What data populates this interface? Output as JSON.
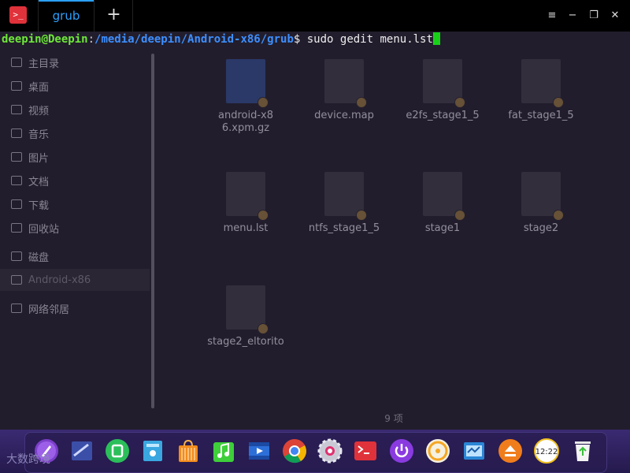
{
  "terminal": {
    "app_icon": ">_",
    "tab_label": "grub",
    "add_tab": "+",
    "prompt_user": "deepin@Deepin",
    "prompt_sep": ":",
    "prompt_path": "/media/deepin/Android-x86/grub",
    "prompt_dollar": "$",
    "command": " sudo gedit menu.lst",
    "menu_glyph": "≡",
    "minimize_glyph": "−",
    "maximize_glyph": "❐",
    "close_glyph": "✕"
  },
  "file_manager": {
    "sidebar": [
      {
        "label": "主目录"
      },
      {
        "label": "桌面"
      },
      {
        "label": "视频"
      },
      {
        "label": "音乐"
      },
      {
        "label": "图片"
      },
      {
        "label": "文档"
      },
      {
        "label": "下载"
      },
      {
        "label": "回收站"
      },
      {
        "label": "磁盘"
      },
      {
        "label": "Android-x86"
      },
      {
        "label": "网络邻居"
      }
    ],
    "files": [
      {
        "name": "android-x86.xpm.gz"
      },
      {
        "name": "device.map"
      },
      {
        "name": "e2fs_stage1_5"
      },
      {
        "name": "fat_stage1_5"
      },
      {
        "name": "menu.lst"
      },
      {
        "name": "ntfs_stage1_5"
      },
      {
        "name": "stage1"
      },
      {
        "name": "stage2"
      },
      {
        "name": "stage2_eltorito"
      }
    ],
    "status": "9 项"
  },
  "dock": {
    "icons": [
      "launcher-icon",
      "screenshot-icon",
      "wechat-icon",
      "file-manager-icon",
      "app-store-icon",
      "music-icon",
      "video-icon",
      "chrome-icon",
      "settings-icon",
      "terminal-icon",
      "power-icon",
      "disk-icon",
      "system-monitor-icon",
      "eject-icon",
      "clock-icon",
      "trash-icon"
    ]
  },
  "watermark": "大数跨境"
}
